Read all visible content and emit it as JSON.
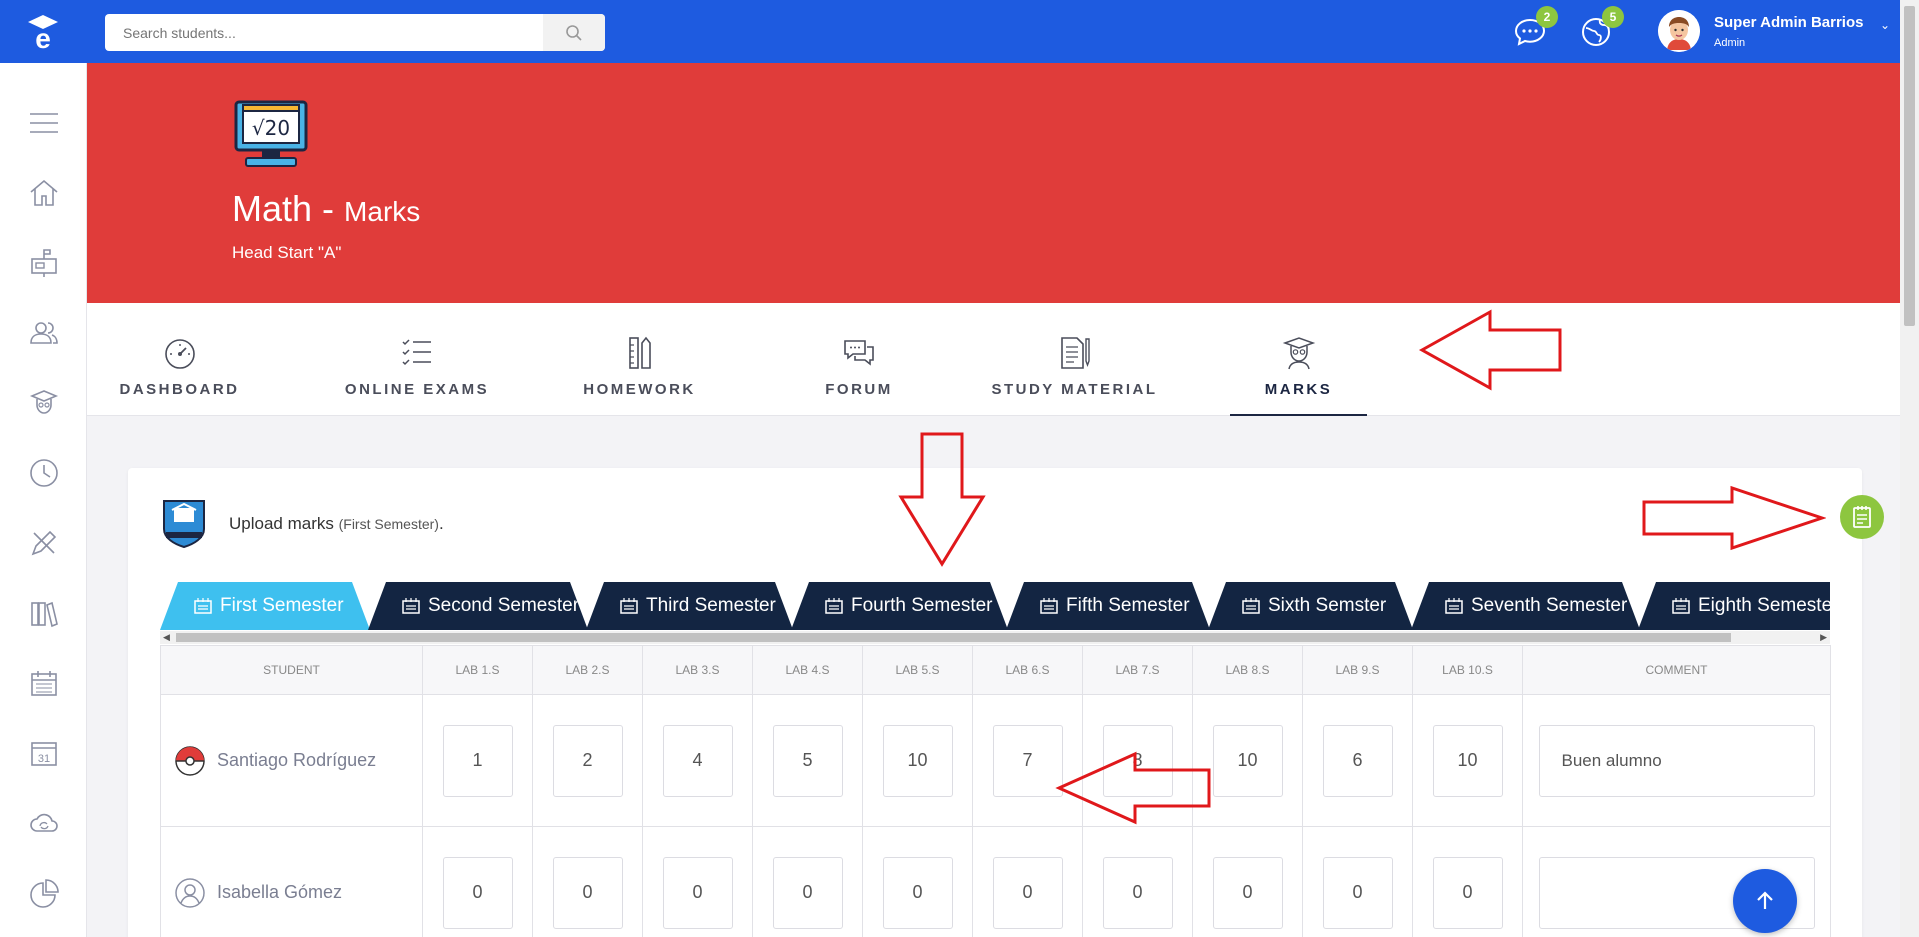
{
  "colors": {
    "primary": "#1e5be0",
    "banner": "#e03c3a",
    "navy": "#132542",
    "active_tab": "#3ec0ef",
    "badge": "#8dc63f",
    "annotation": "#e0181b"
  },
  "topbar": {
    "search_placeholder": "Search students...",
    "messages_badge": "2",
    "notifications_badge": "5",
    "user_name": "Super Admin Barrios",
    "user_role": "Admin"
  },
  "sidebar": {
    "items": [
      "menu-icon",
      "home-icon",
      "mailbox-icon",
      "users-icon",
      "student-icon",
      "clock-icon",
      "pencil-ruler-icon",
      "books-icon",
      "calendar-grid-icon",
      "calendar-31-icon",
      "cloud-sync-icon",
      "pie-chart-icon"
    ]
  },
  "banner": {
    "title": "Math -",
    "title_sub": "Marks",
    "subtitle": "Head Start \"A\""
  },
  "nav_tabs": [
    {
      "label": "DASHBOARD",
      "icon": "gauge-icon"
    },
    {
      "label": "ONLINE EXAMS",
      "icon": "checklist-icon"
    },
    {
      "label": "HOMEWORK",
      "icon": "pencil-ruler-icon"
    },
    {
      "label": "FORUM",
      "icon": "chat-icon"
    },
    {
      "label": "STUDY MATERIAL",
      "icon": "document-pen-icon"
    },
    {
      "label": "MARKS",
      "icon": "graduate-icon",
      "active": true
    }
  ],
  "card": {
    "upload_label": "Upload marks",
    "upload_semester": "(First Semester)",
    "upload_period": "."
  },
  "semesters": [
    "First Semester",
    "Second Semester",
    "Third Semester",
    "Fourth Semester",
    "Fifth Semester",
    "Sixth Semster",
    "Seventh Semester",
    "Eighth Semester"
  ],
  "table": {
    "headers": [
      "STUDENT",
      "LAB 1.S",
      "LAB 2.S",
      "LAB 3.S",
      "LAB 4.S",
      "LAB 5.S",
      "LAB 6.S",
      "LAB 7.S",
      "LAB 8.S",
      "LAB 9.S",
      "LAB 10.S",
      "COMMENT"
    ],
    "rows": [
      {
        "student": "Santiago Rodríguez",
        "marks": [
          "1",
          "2",
          "4",
          "5",
          "10",
          "7",
          "8",
          "10",
          "6",
          "10"
        ],
        "comment": "Buen alumno"
      },
      {
        "student": "Isabella Gómez",
        "marks": [
          "0",
          "0",
          "0",
          "0",
          "0",
          "0",
          "0",
          "0",
          "0",
          "0"
        ],
        "comment": ""
      }
    ]
  }
}
